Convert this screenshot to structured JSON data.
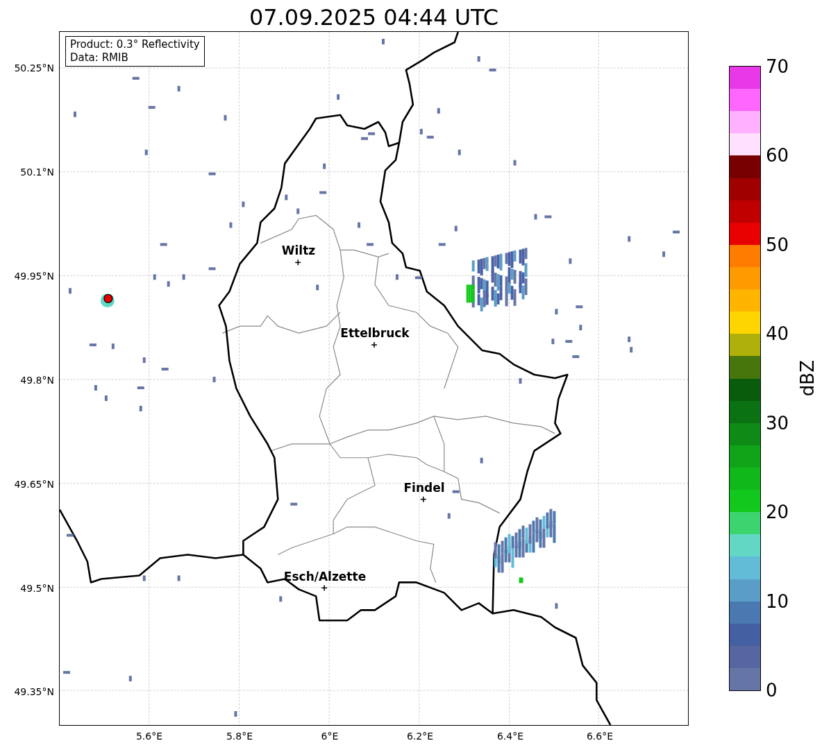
{
  "title": "07.09.2025 04:44 UTC",
  "info_box": {
    "lines": [
      "Product: 0.3° Reflectivity",
      "Data: RMIB"
    ]
  },
  "map": {
    "lat_labels": [
      "50.25°N",
      "50.1°N",
      "49.95°N",
      "49.8°N",
      "49.65°N",
      "49.5°N",
      "49.35°N"
    ],
    "lon_labels": [
      "5.6°E",
      "5.8°E",
      "6°E",
      "6.2°E",
      "6.4°E",
      "6.6°E"
    ],
    "cities": [
      {
        "name": "Wiltz"
      },
      {
        "name": "Ettelbruck"
      },
      {
        "name": "Findel"
      },
      {
        "name": "Esch/Alzette"
      }
    ]
  },
  "colorbar": {
    "label": "dBZ",
    "ticks": [
      "70",
      "60",
      "50",
      "40",
      "30",
      "20",
      "10",
      "0"
    ],
    "bins": [
      {
        "color": "#e838e8"
      },
      {
        "color": "#ff66ff"
      },
      {
        "color": "#ffb0ff"
      },
      {
        "color": "#ffe0ff"
      },
      {
        "color": "#780000"
      },
      {
        "color": "#a00000"
      },
      {
        "color": "#c00000"
      },
      {
        "color": "#e80000"
      },
      {
        "color": "#ff7c00"
      },
      {
        "color": "#ff9a00"
      },
      {
        "color": "#ffb500"
      },
      {
        "color": "#ffd500"
      },
      {
        "color": "#b0b00a"
      },
      {
        "color": "#46760c"
      },
      {
        "color": "#085c0c"
      },
      {
        "color": "#0a7212"
      },
      {
        "color": "#0e8a16"
      },
      {
        "color": "#10a418"
      },
      {
        "color": "#10b81a"
      },
      {
        "color": "#12c81c"
      },
      {
        "color": "#3cd46e"
      },
      {
        "color": "#62d8c4"
      },
      {
        "color": "#62bcd8"
      },
      {
        "color": "#5a9ec8"
      },
      {
        "color": "#4a78b0"
      },
      {
        "color": "#4560a2"
      },
      {
        "color": "#5566a0"
      },
      {
        "color": "#6475a6"
      }
    ]
  }
}
